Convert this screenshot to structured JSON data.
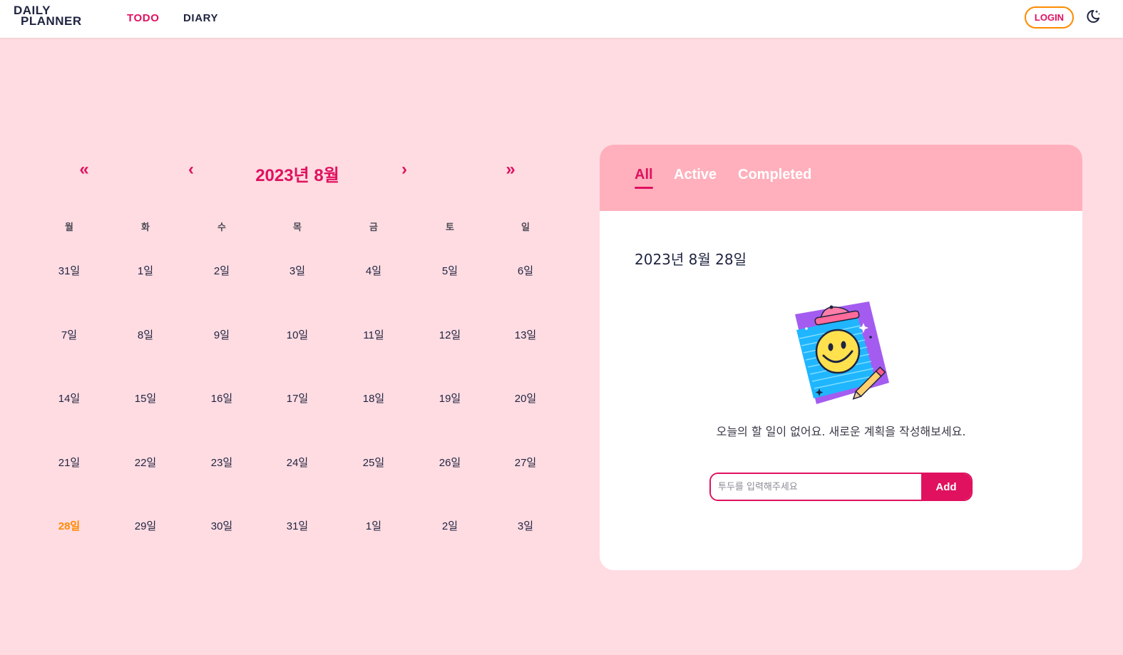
{
  "header": {
    "logo_line1": "DAILY",
    "logo_line2": "PLANNER",
    "nav": {
      "todo": "TODO",
      "diary": "DIARY"
    },
    "login_label": "LOGIN",
    "theme_icon": "moon-stars-icon",
    "active_nav": "TODO"
  },
  "calendar": {
    "title": "2023년 8월",
    "nav_prev_year": "«",
    "nav_prev_month": "‹",
    "nav_next_month": "›",
    "nav_next_year": "»",
    "weekdays": [
      "월",
      "화",
      "수",
      "목",
      "금",
      "토",
      "일"
    ],
    "weeks": [
      [
        "31일",
        "1일",
        "2일",
        "3일",
        "4일",
        "5일",
        "6일"
      ],
      [
        "7일",
        "8일",
        "9일",
        "10일",
        "11일",
        "12일",
        "13일"
      ],
      [
        "14일",
        "15일",
        "16일",
        "17일",
        "18일",
        "19일",
        "20일"
      ],
      [
        "21일",
        "22일",
        "23일",
        "24일",
        "25일",
        "26일",
        "27일"
      ],
      [
        "28일",
        "29일",
        "30일",
        "31일",
        "1일",
        "2일",
        "3일"
      ]
    ],
    "selected_day": "28일"
  },
  "todo_panel": {
    "tabs": [
      "All",
      "Active",
      "Completed"
    ],
    "active_tab": "All",
    "date_heading": "2023년 8월 28일",
    "empty_message": "오늘의 할 일이 없어요. 새로운 계획을 작성해보세요.",
    "illustration_icon": "smiley-clipboard-icon",
    "input_value": "",
    "input_placeholder": "투두를 입력해주세요",
    "add_label": "Add"
  },
  "colors": {
    "accent": "#e0115f",
    "today": "#ff8a00",
    "page_bg": "#ffdce2",
    "panel_header": "#ffb0bc"
  }
}
